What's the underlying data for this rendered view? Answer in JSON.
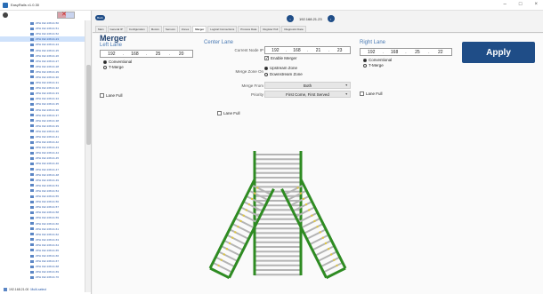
{
  "window": {
    "title": "EasyRails v1.0.30",
    "controls": [
      "–",
      "□",
      "×"
    ]
  },
  "tree": {
    "items": [
      "ZPH 192.168.21.50",
      "ZPH 192.168.21.51",
      "ZPH 192.168.21.52",
      "ZPH 192.168.21.23",
      "ZPH 192.168.21.24",
      "ZPH 192.168.21.25",
      "ZPH 192.168.21.26",
      "ZPH 192.168.21.27",
      "ZPH 192.168.21.28",
      "ZPH 192.168.21.29",
      "ZPH 192.168.21.30",
      "ZPH 192.168.21.31",
      "ZPH 192.168.21.32",
      "ZPH 192.168.21.33",
      "ZPH 192.168.21.34",
      "ZPH 192.168.21.35",
      "ZPH 192.168.21.36",
      "ZPH 192.168.21.37",
      "ZPH 192.168.21.38",
      "ZPH 192.168.21.39",
      "ZPH 192.168.21.40",
      "ZPH 192.168.21.41",
      "ZPH 192.168.21.42",
      "ZPH 192.168.21.43",
      "ZPH 192.168.21.44",
      "ZPH 192.168.21.45",
      "ZPH 192.168.21.46",
      "ZPH 192.168.21.47",
      "ZPH 192.168.21.48",
      "ZPH 192.168.21.49",
      "ZPH 192.168.21.53",
      "ZPH 192.168.21.54",
      "ZPH 192.168.21.55",
      "ZPH 192.168.21.56",
      "ZPH 192.168.21.57",
      "ZPH 192.168.21.58",
      "ZPH 192.168.21.59",
      "ZPH 192.168.21.60",
      "ZPH 192.168.21.61",
      "ZPH 192.168.21.62",
      "ZPH 192.168.21.63",
      "ZPH 192.168.21.64",
      "ZPH 192.168.21.65",
      "ZPH 192.168.21.66",
      "ZPH 192.168.21.67",
      "ZPH 192.168.21.68",
      "ZPH 192.168.21.69",
      "ZPH 192.168.21.70"
    ],
    "selected_index": 3,
    "bottom_label": "192.168.21.00",
    "bottom_link": "Multi-select"
  },
  "header": {
    "back_label": "Back",
    "ip": "192.168.21.23"
  },
  "tabs": [
    "Main",
    "General IP",
    "Configuration",
    "Motors",
    "Sensors",
    "Zones",
    "Merger",
    "Logical Connections",
    "Process Data",
    "Register Poll",
    "Diagnostic Data"
  ],
  "active_tab": 6,
  "merger": {
    "title": "Merger",
    "left_lane": {
      "heading": "Left Lane",
      "ip": [
        "192",
        "168",
        "25",
        "20"
      ],
      "conventional": "Conventional",
      "tmerge": "T-Merge",
      "lane_full": "Lane Full"
    },
    "center_lane": {
      "heading": "Center Lane",
      "current_node_ip_label": "Current Node IP",
      "ip": [
        "192",
        "168",
        "21",
        "23"
      ],
      "enable_merger": "Enable Merger",
      "merge_zone_on_label": "Merge Zone On",
      "upstream": "Upstream Zone",
      "downstream": "Downstream Zone",
      "merge_from_label": "Merge From",
      "merge_from_value": "Both",
      "priority_label": "Priority",
      "priority_value": "First Come, First Served",
      "lane_full": "Lane Full"
    },
    "right_lane": {
      "heading": "Right Lane",
      "ip": [
        "192",
        "168",
        "25",
        "22"
      ],
      "conventional": "Conventional",
      "tmerge": "T-Merge",
      "lane_full": "Lane Full"
    },
    "apply_label": "Apply"
  },
  "colors": {
    "accent": "#1f4d87",
    "rail_green": "#2e8b22",
    "roller_gray": "#b4b4b4"
  }
}
